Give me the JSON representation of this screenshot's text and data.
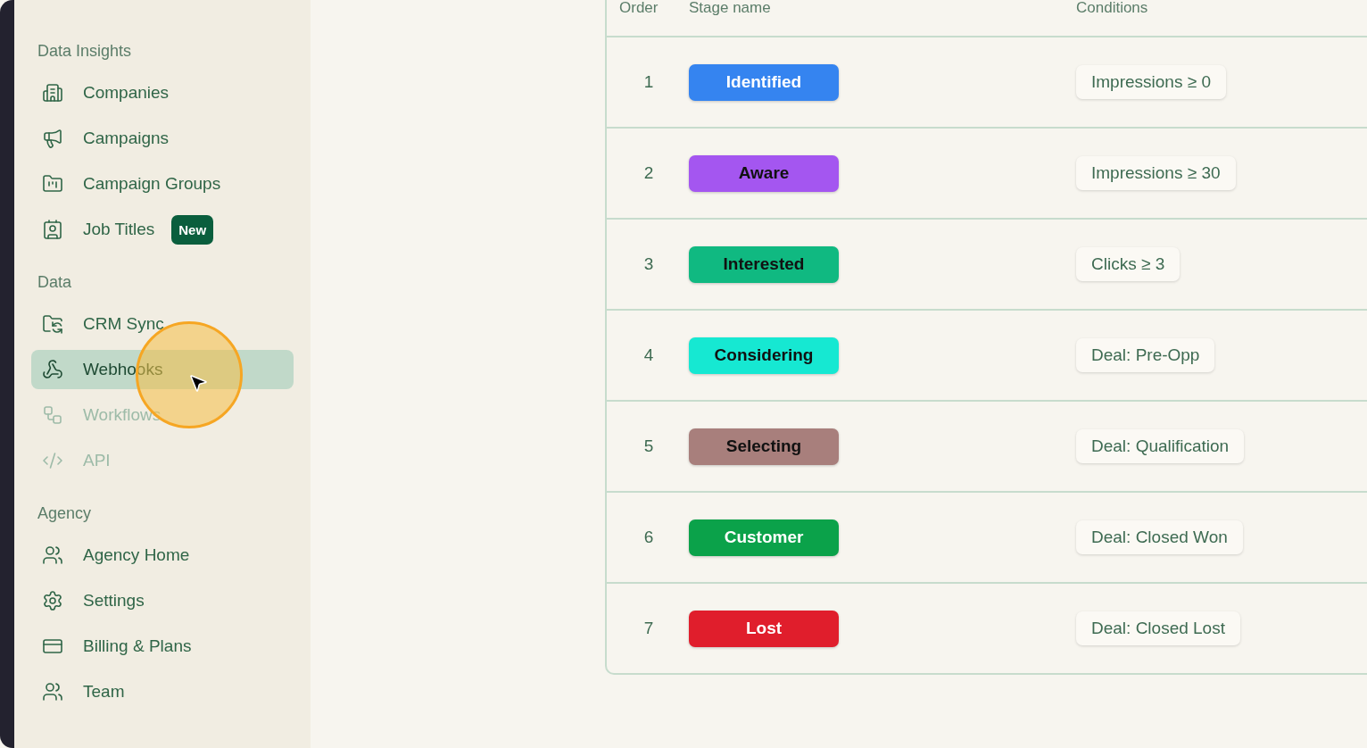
{
  "sidebar": {
    "sections": [
      {
        "heading": "Data Insights",
        "items": [
          {
            "label": "Companies",
            "selected": false,
            "disabled": false
          },
          {
            "label": "Campaigns",
            "selected": false,
            "disabled": false
          },
          {
            "label": "Campaign Groups",
            "selected": false,
            "disabled": false
          },
          {
            "label": "Job Titles",
            "selected": false,
            "disabled": false,
            "badge": "New"
          }
        ]
      },
      {
        "heading": "Data",
        "items": [
          {
            "label": "CRM Sync",
            "selected": false,
            "disabled": false
          },
          {
            "label": "Webhooks",
            "selected": true,
            "disabled": false
          },
          {
            "label": "Workflows",
            "selected": false,
            "disabled": true
          },
          {
            "label": "API",
            "selected": false,
            "disabled": true
          }
        ]
      },
      {
        "heading": "Agency",
        "items": [
          {
            "label": "Agency Home",
            "selected": false,
            "disabled": false
          },
          {
            "label": "Settings",
            "selected": false,
            "disabled": false
          },
          {
            "label": "Billing & Plans",
            "selected": false,
            "disabled": false
          },
          {
            "label": "Team",
            "selected": false,
            "disabled": false
          }
        ]
      }
    ]
  },
  "table": {
    "columns": [
      "Order",
      "Stage name",
      "Conditions"
    ],
    "rows": [
      {
        "order": "1",
        "stage": "Identified",
        "color": "#3584f0",
        "dark_text": false,
        "condition": "Impressions ≥ 0"
      },
      {
        "order": "2",
        "stage": "Aware",
        "color": "#a456f0",
        "dark_text": true,
        "condition": "Impressions ≥ 30"
      },
      {
        "order": "3",
        "stage": "Interested",
        "color": "#10b981",
        "dark_text": true,
        "condition": "Clicks ≥ 3"
      },
      {
        "order": "4",
        "stage": "Considering",
        "color": "#16e8d2",
        "dark_text": true,
        "condition": "Deal: Pre-Opp"
      },
      {
        "order": "5",
        "stage": "Selecting",
        "color": "#a87f7c",
        "dark_text": true,
        "condition": "Deal: Qualification"
      },
      {
        "order": "6",
        "stage": "Customer",
        "color": "#0ba24a",
        "dark_text": false,
        "condition": "Deal: Closed Won"
      },
      {
        "order": "7",
        "stage": "Lost",
        "color": "#e01e2c",
        "dark_text": false,
        "condition": "Deal: Closed Lost"
      }
    ]
  }
}
